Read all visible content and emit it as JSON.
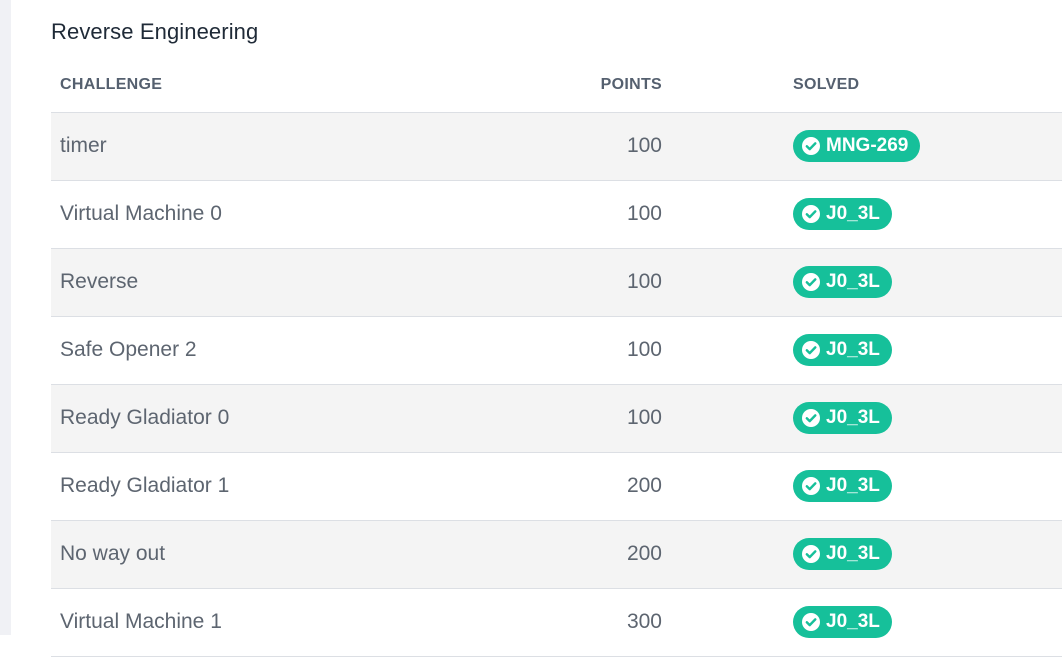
{
  "section": {
    "title": "Reverse Engineering"
  },
  "table": {
    "headers": {
      "challenge": "CHALLENGE",
      "points": "POINTS",
      "solved": "SOLVED"
    },
    "rows": [
      {
        "name": "timer",
        "points": "100",
        "solver": "MNG-269"
      },
      {
        "name": "Virtual Machine 0",
        "points": "100",
        "solver": "J0_3L"
      },
      {
        "name": "Reverse",
        "points": "100",
        "solver": "J0_3L"
      },
      {
        "name": "Safe Opener 2",
        "points": "100",
        "solver": "J0_3L"
      },
      {
        "name": "Ready Gladiator 0",
        "points": "100",
        "solver": "J0_3L"
      },
      {
        "name": "Ready Gladiator 1",
        "points": "200",
        "solver": "J0_3L"
      },
      {
        "name": "No way out",
        "points": "200",
        "solver": "J0_3L"
      },
      {
        "name": "Virtual Machine 1",
        "points": "300",
        "solver": "J0_3L"
      }
    ]
  },
  "colors": {
    "badge": "#16c09a",
    "row_alt": "#f4f4f4",
    "text": "#5d6570",
    "header": "#55606f"
  },
  "icons": {
    "badge_icon": "check-circle-icon"
  }
}
